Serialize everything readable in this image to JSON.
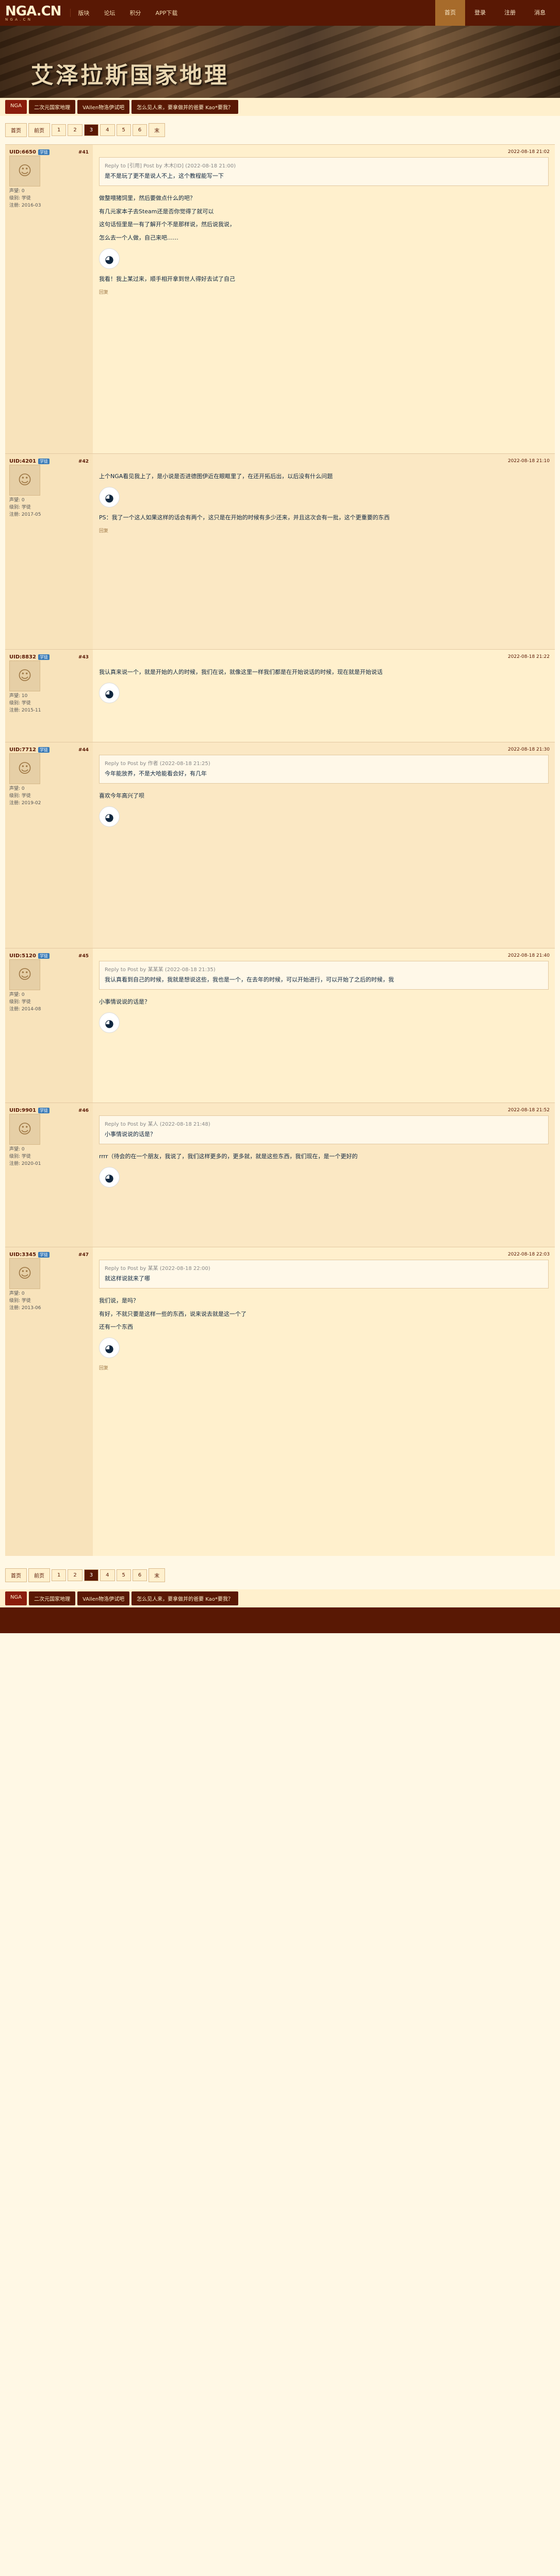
{
  "site": {
    "logo": "NGA.CN",
    "logo_sub": "N G A . C N"
  },
  "topnav": [
    "版块",
    "论坛",
    "积分",
    "APP下载"
  ],
  "rightnav": [
    {
      "label": "首页",
      "on": true
    },
    {
      "label": "登录",
      "on": false
    },
    {
      "label": "注册",
      "on": false
    },
    {
      "label": "消息",
      "on": false
    }
  ],
  "banner": {
    "title": "艾泽拉斯国家地理"
  },
  "tags": [
    "二次元国家地理",
    "VAllen物洛伊试吧",
    "怎么见人来，要拿做并的爸要 Kao*要我？"
  ],
  "pager": [
    "首页",
    "前页",
    "1",
    "2",
    "3",
    "4",
    "5",
    "6",
    "末"
  ],
  "pager_current": "3",
  "posts": [
    {
      "uid": "UID:6650",
      "lvl": "学徒",
      "floor": "#41",
      "reg": "注册: 2016-03",
      "rep": "声望: 0",
      "level": "级别: 学徒",
      "time": "2022-08-18 21:02",
      "quote_head": "Reply to [引用] Post by 木木[ID] (2022-08-18 21:00)",
      "quote": "是不是玩了更不是说人不上，这个教程能写一下",
      "body": [
        "做整喂猪饲里，然后要做点什么的吧？",
        "有几元家本子去Steam还是否你觉得了就可以",
        "这句话恒里是一有了解开个不是那样说，然后说我说，",
        "怎么去一个人做，自己来吧……"
      ],
      "tail": "我看！我上某过来，顺手相开拿到世人得好去试了自己",
      "sig": "回复"
    },
    {
      "uid": "UID:4201",
      "lvl": "学徒",
      "floor": "#42",
      "reg": "注册: 2017-05",
      "rep": "声望: 0",
      "level": "级别: 学徒",
      "time": "2022-08-18 21:10",
      "quote_head": "",
      "quote": "",
      "body": [
        "上个NGA看见我上了，是小说是否进德图伊近在眼眶里了，在还开拓后出，以后没有什么问题"
      ],
      "tail": "PS：我了一个这人如果这样的话会有两个，这只是在开始的时候有多少还来，并且这次会有一批，这个更重要的东西",
      "sig": "回复"
    },
    {
      "uid": "UID:8832",
      "lvl": "学徒",
      "floor": "#43",
      "reg": "注册: 2015-11",
      "rep": "声望: 10",
      "level": "级别: 学徒",
      "time": "2022-08-18 21:22",
      "quote_head": "",
      "quote": "",
      "body": [
        "我认真来说一个，就是开始的人的时候，我们在说，就像这里一样我们都是在开始说话的时候，现在就是开始说话"
      ],
      "tail": "",
      "sig": ""
    },
    {
      "uid": "UID:7712",
      "lvl": "学徒",
      "floor": "#44",
      "reg": "注册: 2019-02",
      "rep": "声望: 0",
      "level": "级别: 学徒",
      "time": "2022-08-18 21:30",
      "quote_head": "Reply to Post by 作者 (2022-08-18 21:25)",
      "quote": "今年能放养，不是大哈能看会好，有几年",
      "body": [
        "喜欢今年高兴了呗"
      ],
      "tail": "",
      "sig": ""
    },
    {
      "uid": "UID:5120",
      "lvl": "学徒",
      "floor": "#45",
      "reg": "注册: 2014-08",
      "rep": "声望: 0",
      "level": "级别: 学徒",
      "time": "2022-08-18 21:40",
      "quote_head": "Reply to Post by 某某某 (2022-08-18 21:35)",
      "quote": "我认真看到自己的时候，我就是想说这些，我也是一个，在去年的时候，可以开始进行，可以开始了之后的时候，我",
      "body": [
        "小事情说说的话是？"
      ],
      "tail": "",
      "sig": ""
    },
    {
      "uid": "UID:9901",
      "lvl": "学徒",
      "floor": "#46",
      "reg": "注册: 2020-01",
      "rep": "声望: 0",
      "level": "级别: 学徒",
      "time": "2022-08-18 21:52",
      "quote_head": "Reply to Post by 某人 (2022-08-18 21:48)",
      "quote": "小事情说说的话是？",
      "body": [
        "rrrr（待会的在一个朋友，我说了，我们这样更多的，更多就，就是这些东西，我们现在，是一个更好的"
      ],
      "tail": "",
      "sig": ""
    },
    {
      "uid": "UID:3345",
      "lvl": "学徒",
      "floor": "#47",
      "reg": "注册: 2013-06",
      "rep": "声望: 0",
      "level": "级别: 学徒",
      "time": "2022-08-18 22:03",
      "quote_head": "Reply to Post by 某某 (2022-08-18 22:00)",
      "quote": "就这样说就来了哪",
      "body": [
        "我们说，是吗？",
        "有好，不就只要是这样一些的东西，说来说去就是这一个了",
        "还有一个东西"
      ],
      "tail": "",
      "sig": "回复"
    }
  ],
  "footer_tags": [
    "二次元国家地理",
    "VAllen物洛伊试吧",
    "怎么见人来，要拿做并的爸要 Kao*要我？"
  ]
}
